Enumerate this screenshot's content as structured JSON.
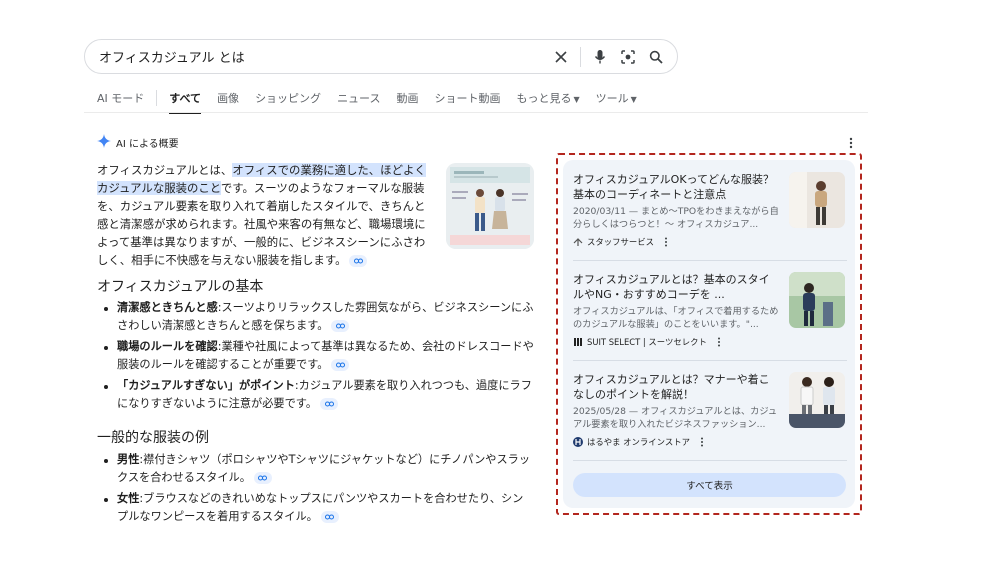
{
  "search": {
    "query": "オフィスカジュアル とは"
  },
  "tabs": [
    {
      "label": "AI モード"
    },
    {
      "label": "すべて"
    },
    {
      "label": "画像"
    },
    {
      "label": "ショッピング"
    },
    {
      "label": "ニュース"
    },
    {
      "label": "動画"
    },
    {
      "label": "ショート動画"
    },
    {
      "label": "もっと見る"
    },
    {
      "label": "ツール"
    }
  ],
  "ai_overview": {
    "title": "AI による概要",
    "intro_pre": "オフィスカジュアルとは、",
    "intro_highlight": "オフィスでの業務に適した、ほどよくカジュアルな服装のこと",
    "intro_post": "です。スーツのようなフォーマルな服装を、カジュアル要素を取り入れて着崩したスタイルで、きちんと感と清潔感が求められます。社風や来客の有無など、職場環境によって基準は異なりますが、一般的に、ビジネスシーンにふさわしく、相手に不快感を与えない服装を指します。",
    "sections": [
      {
        "heading": "オフィスカジュアルの基本",
        "items": [
          {
            "term": "清潔感ときちんと感",
            "text": ":スーツよりリラックスした雰囲気ながら、ビジネスシーンにふさわしい清潔感ときちんと感を保ちます。"
          },
          {
            "term": "職場のルールを確認",
            "text": ":業種や社風によって基準は異なるため、会社のドレスコードや服装のルールを確認することが重要です。"
          },
          {
            "term": "「カジュアルすぎない」がポイント",
            "text": ":カジュアル要素を取り入れつつも、過度にラフになりすぎないように注意が必要です。"
          }
        ]
      },
      {
        "heading": "一般的な服装の例",
        "items": [
          {
            "term": "男性",
            "text": ":襟付きシャツ（ポロシャツやTシャツにジャケットなど）にチノパンやスラックスを合わせるスタイル。"
          },
          {
            "term": "女性",
            "text": ":ブラウスなどのきれいめなトップスにパンツやスカートを合わせたり、シンプルなワンピースを着用するスタイル。"
          }
        ]
      }
    ]
  },
  "sources": {
    "cards": [
      {
        "title": "オフィスカジュアルOKってどんな服装？基本のコーディネートと注意点",
        "snippet": "2020/03/11 — まとめ〜TPOをわきまえながら自分らしくはつらつと！〜 オフィスカジュア...",
        "source": "スタッフサービス"
      },
      {
        "title": "オフィスカジュアルとは？基本のスタイルやNG・おすすめコーデを ...",
        "snippet": "オフィスカジュアルは、「オフィスで着用するためのカジュアルな服装」のことをいいます。\"...",
        "source": "SUIT SELECT | スーツセレクト"
      },
      {
        "title": "オフィスカジュアルとは？マナーや着こなしのポイントを解説！",
        "snippet": "2025/05/28 — オフィスカジュアルとは、カジュアル要素を取り入れたビジネスファッション...",
        "source": "はるやま オンラインストア"
      }
    ],
    "show_all_label": "すべて表示"
  },
  "colors": {
    "panel_bg": "#f0f4f9",
    "highlight": "#d3e3fd",
    "dashed_frame": "#b3261e"
  }
}
